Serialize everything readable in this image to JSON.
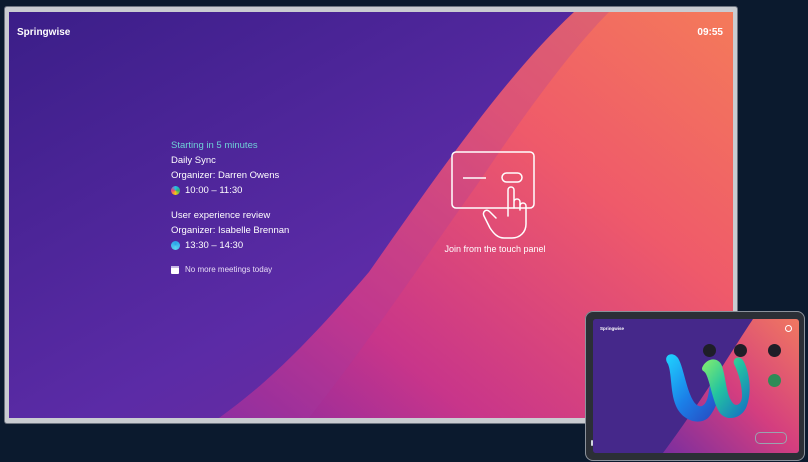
{
  "display": {
    "brand": "Springwise",
    "clock": "09:55",
    "colors": {
      "purple": "#5a2a9e",
      "coral": "#f06a4f",
      "teal_text": "#6fd0d7"
    },
    "meetings": [
      {
        "status": "Starting in 5 minutes",
        "title": "Daily Sync",
        "organizer": "Organizer: Darren Owens",
        "time": "10:00 – 11:30",
        "icon": "webex-multicolor-icon"
      },
      {
        "title": "User experience review",
        "organizer": "Organizer: Isabelle Brennan",
        "time": "13:30 – 14:30",
        "icon": "webex-blue-icon"
      }
    ],
    "no_more": "No more meetings today",
    "touch_prompt": "Join from the touch panel",
    "touch_icon": "touch-panel-icon"
  },
  "tablet": {
    "brand": "Springwise",
    "logo": "webex-logo"
  }
}
